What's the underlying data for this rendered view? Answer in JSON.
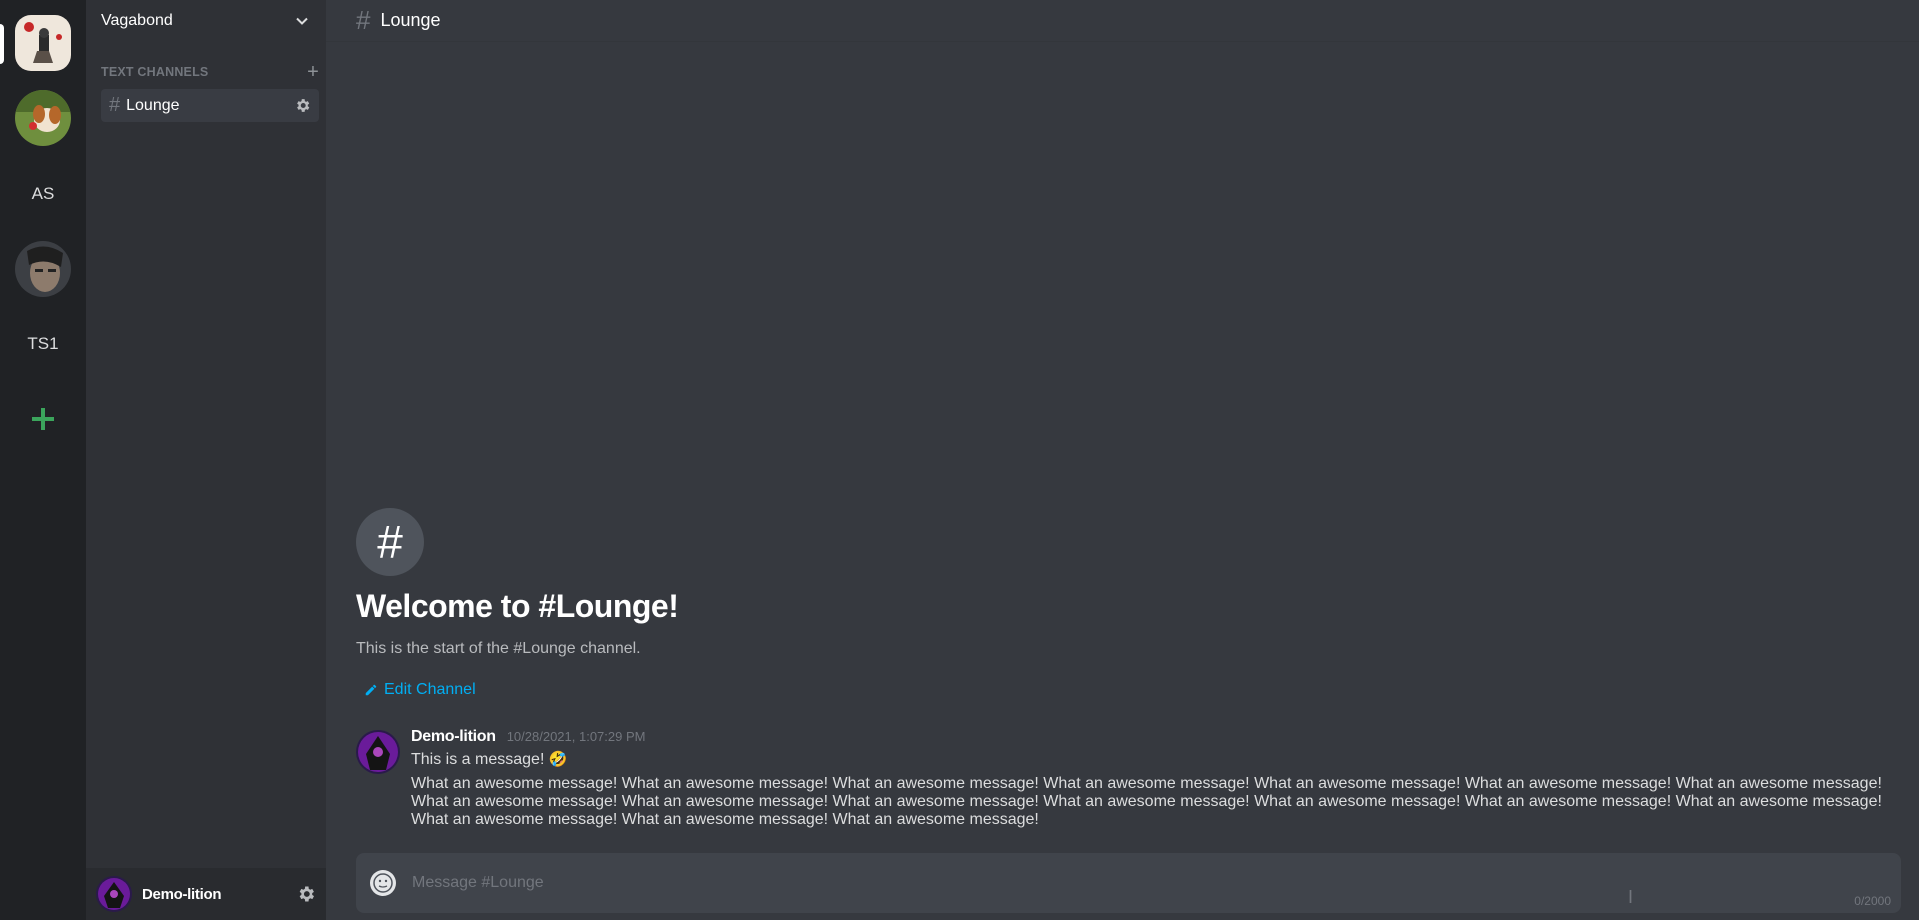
{
  "servers": [
    {
      "type": "image",
      "icon": "server-vagabond-icon",
      "active": true
    },
    {
      "type": "image",
      "icon": "server-dog-icon",
      "active": false
    },
    {
      "type": "text",
      "label": "AS",
      "active": false
    },
    {
      "type": "image",
      "icon": "server-portrait-icon",
      "active": false
    },
    {
      "type": "text",
      "label": "TS1",
      "active": false
    }
  ],
  "add_server_icon": "plus-icon",
  "server_header": {
    "name": "Vagabond"
  },
  "channels": {
    "category_label": "TEXT CHANNELS",
    "items": [
      {
        "label": "Lounge",
        "active": true
      }
    ]
  },
  "user": {
    "name": "Demo-lition"
  },
  "chat_header": {
    "title": "Lounge"
  },
  "welcome": {
    "title": "Welcome to #Lounge!",
    "subtitle": "This is the start of the #Lounge channel.",
    "edit_label": "Edit Channel"
  },
  "messages": [
    {
      "author": "Demo-lition",
      "timestamp": "10/28/2021, 1:07:29 PM",
      "line1": "This is a message!",
      "line1_emoji": "🤣",
      "line2": "What an awesome message! What an awesome message! What an awesome message! What an awesome message! What an awesome message! What an awesome message! What an awesome message! What an awesome message! What an awesome message! What an awesome message! What an awesome message! What an awesome message! What an awesome message! What an awesome message! What an awesome message! What an awesome message! What an awesome message!"
    }
  ],
  "composer": {
    "placeholder": "Message #Lounge",
    "value": "",
    "counter": "0/2000"
  },
  "colors": {
    "rail": "#202225",
    "sidebar": "#2f3136",
    "main": "#36393f",
    "link": "#00aff4",
    "add_server": "#3ba55c"
  }
}
